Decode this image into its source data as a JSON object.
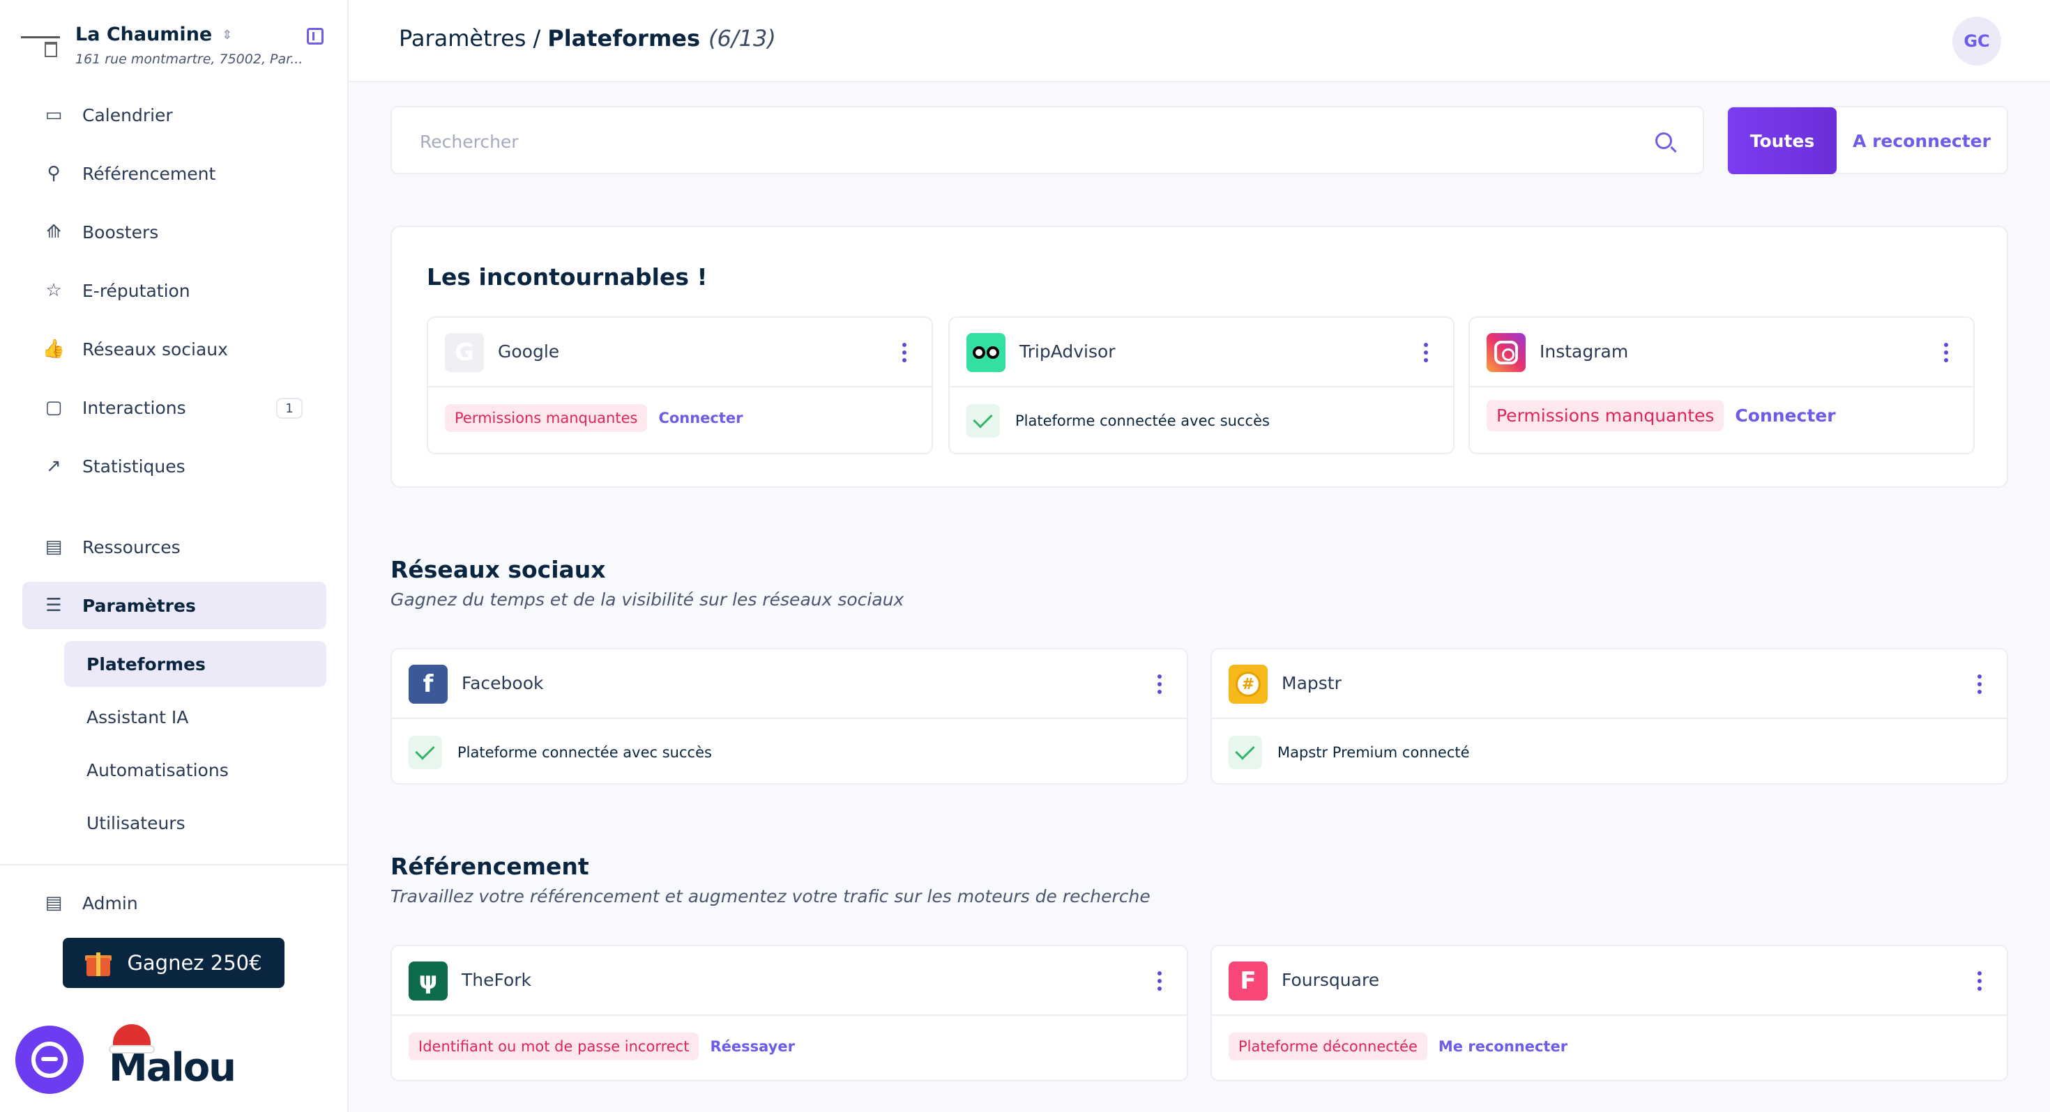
{
  "sidebar": {
    "restaurant_name": "La Chaumine",
    "restaurant_address": "161 rue montmartre, 75002, Par...",
    "nav": {
      "calendrier": "Calendrier",
      "referencement": "Référencement",
      "boosters": "Boosters",
      "ereputation": "E-réputation",
      "reseaux": "Réseaux sociaux",
      "interactions": "Interactions",
      "interactions_badge": "1",
      "statistiques": "Statistiques",
      "ressources": "Ressources",
      "parametres": "Paramètres"
    },
    "sub": {
      "plateformes": "Plateformes",
      "assistant": "Assistant IA",
      "automatisations": "Automatisations",
      "utilisateurs": "Utilisateurs"
    },
    "admin": "Admin",
    "gift_label": "Gagnez 250€",
    "logo_text": "Malou"
  },
  "header": {
    "breadcrumb_parent": "Paramètres",
    "breadcrumb_sep": "/",
    "breadcrumb_current": "Plateformes",
    "count": "(6/13)",
    "avatar_initials": "GC"
  },
  "search": {
    "placeholder": "Rechercher"
  },
  "filters": {
    "all": "Toutes",
    "reconnect": "A reconnecter"
  },
  "incontournables": {
    "title": "Les incontournables !",
    "google": {
      "name": "Google",
      "status": "Permissions manquantes",
      "action": "Connecter"
    },
    "tripadvisor": {
      "name": "TripAdvisor",
      "status": "Plateforme connectée avec succès"
    },
    "instagram": {
      "name": "Instagram",
      "status": "Permissions manquantes",
      "action": "Connecter"
    }
  },
  "reseaux": {
    "title": "Réseaux sociaux",
    "subtitle": "Gagnez du temps et de la visibilité sur les réseaux sociaux",
    "facebook": {
      "name": "Facebook",
      "status": "Plateforme connectée avec succès"
    },
    "mapstr": {
      "name": "Mapstr",
      "status": "Mapstr Premium connecté"
    }
  },
  "referencement": {
    "title": "Référencement",
    "subtitle": "Travaillez votre référencement et augmentez votre trafic sur les moteurs de recherche",
    "thefork": {
      "name": "TheFork",
      "status": "Identifiant ou mot de passe incorrect",
      "action": "Réessayer"
    },
    "foursquare": {
      "name": "Foursquare",
      "status": "Plateforme déconnectée",
      "action": "Me reconnecter"
    }
  },
  "colors": {
    "accent": "#6c5ce7",
    "navy": "#0a2540",
    "error": "#e0245e",
    "success": "#34b36b"
  }
}
